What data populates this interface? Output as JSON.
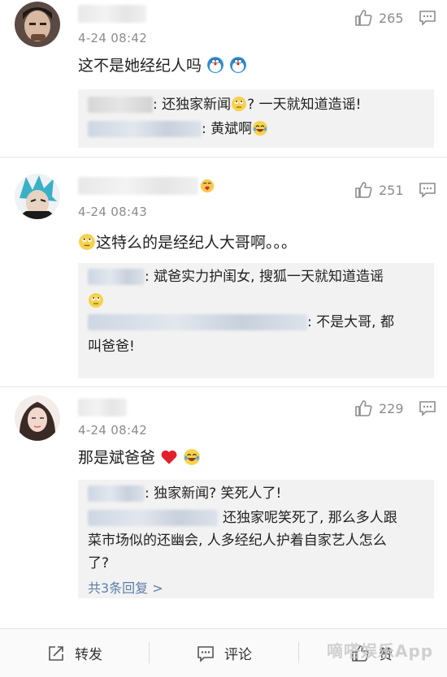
{
  "comments": [
    {
      "time": "4-24 08:42",
      "text": "这不是她经纪人吗",
      "likes": "265",
      "replies": [
        {
          "text": ": 还独家新闻",
          "text2": "? 一天就知道造谣!"
        },
        {
          "text": ": 黄斌啊"
        }
      ]
    },
    {
      "time": "4-24 08:43",
      "text": "这特么的是经纪人大哥啊。。。",
      "likes": "251",
      "replies": [
        {
          "text": ": 斌爸实力护闺女, 搜狐一天就知道造谣"
        },
        {
          "text": ": 不是大哥, 都",
          "text2": "叫爸爸!"
        }
      ]
    },
    {
      "time": "4-24 08:42",
      "text": "那是斌爸爸",
      "likes": "229",
      "replies": [
        {
          "text": ": 独家新闻? 笑死人了!"
        },
        {
          "text": "还独家呢笑死了, 那么多人跟",
          "text2": "菜市场似的还幽会, 人多经纪人护着自家艺人怎么",
          "text3": "了?"
        }
      ],
      "more": "共3条回复 >"
    }
  ],
  "toolbar": {
    "repost": "转发",
    "comment": "评论",
    "like": "赞"
  },
  "watermark": "嘀嗒娱乐App",
  "colors": {
    "link": "#5d7da8",
    "meta": "#8c8c8c",
    "reply_bg": "#f2f2f2",
    "heart": "#e0202a"
  },
  "icons": [
    "thumbs-up-icon",
    "reply-icon",
    "repost-icon",
    "comment-icon",
    "emoji-rolleyes",
    "emoji-laugh-cry",
    "emoji-doraemon",
    "heart-icon"
  ]
}
